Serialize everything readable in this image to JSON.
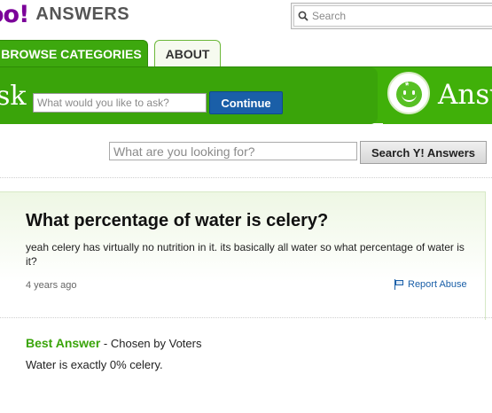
{
  "header": {
    "logo_text": "oo!",
    "logo_product": "ANSWERS",
    "search_placeholder": "Search"
  },
  "tabs": [
    {
      "label": "BROWSE CATEGORIES",
      "active": true
    },
    {
      "label": "ABOUT",
      "active": false
    }
  ],
  "ask_bar": {
    "label_fragment": "sk",
    "input_placeholder": "What would you like to ask?",
    "continue_label": "Continue",
    "brand_fragment": "Answ"
  },
  "search_answers": {
    "input_placeholder": "What are you looking for?",
    "button_label": "Search Y! Answers"
  },
  "question": {
    "title": "What percentage of water is celery?",
    "body": "yeah celery has virtually no nutrition in it. its basically all water so what percentage of water is it?",
    "timestamp": "4 years ago",
    "report_label": "Report Abuse"
  },
  "best_answer": {
    "heading": "Best Answer",
    "chosen_by": " - Chosen by Voters",
    "text": "Water is exactly 0% celery."
  },
  "colors": {
    "brand_purple": "#7b0099",
    "brand_green": "#40b009",
    "link_blue": "#1a5fa8"
  }
}
